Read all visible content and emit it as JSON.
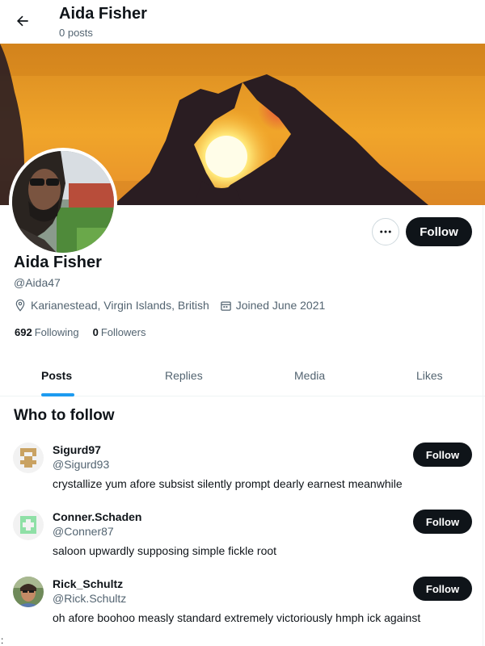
{
  "header": {
    "title": "Aida Fisher",
    "post_count": "0 posts",
    "back_icon": "arrow-left-icon"
  },
  "profile": {
    "name": "Aida Fisher",
    "handle": "@Aida47",
    "location": "Karianestead, Virgin Islands, British",
    "joined": "Joined June 2021",
    "following_count": "692",
    "following_label": "Following",
    "followers_count": "0",
    "followers_label": "Followers",
    "follow_label": "Follow",
    "more_icon": "more-horizontal-icon",
    "location_icon": "location-pin-icon",
    "calendar_icon": "calendar-icon"
  },
  "tabs": [
    {
      "label": "Posts",
      "active": true
    },
    {
      "label": "Replies",
      "active": false
    },
    {
      "label": "Media",
      "active": false
    },
    {
      "label": "Likes",
      "active": false
    }
  ],
  "who_to_follow": {
    "title": "Who to follow",
    "items": [
      {
        "name": "Sigurd97",
        "handle": "@Sigurd93",
        "bio": "crystallize yum afore subsist silently prompt dearly earnest meanwhile",
        "follow_label": "Follow"
      },
      {
        "name": "Conner.Schaden",
        "handle": "@Conner87",
        "bio": "saloon upwardly supposing simple fickle root",
        "follow_label": "Follow"
      },
      {
        "name": "Rick_Schultz",
        "handle": "@Rick.Schultz",
        "bio": "oh afore boohoo measly standard extremely victoriously hmph ick against",
        "follow_label": "Follow"
      }
    ]
  },
  "stray_text": ":",
  "colors": {
    "accent": "#1d9bf0",
    "button_dark": "#0f1419",
    "muted_text": "#536471",
    "identicon_1": "#c9a262",
    "identicon_2": "#8fe0a6"
  }
}
